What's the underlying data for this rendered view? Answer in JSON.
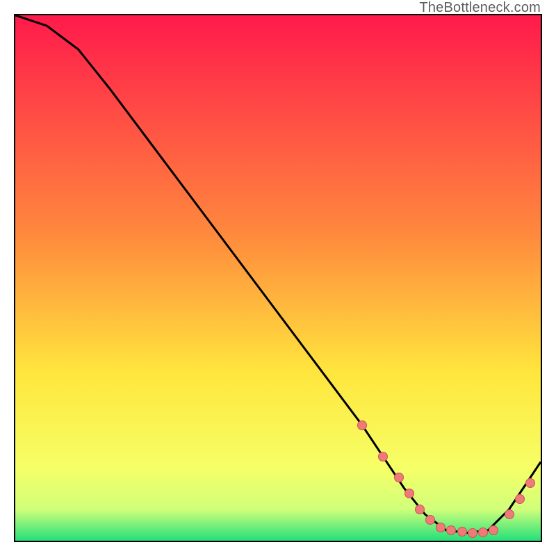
{
  "watermark": "TheBottleneck.com",
  "colors": {
    "top": "#ff1a4b",
    "mid1": "#ff8a3d",
    "mid2": "#ffe63d",
    "mid3": "#f6ff66",
    "mid4": "#d1ff7a",
    "bottom": "#23e07a",
    "curve": "#000000",
    "dot_fill": "#f07a78",
    "dot_stroke": "#c95553"
  },
  "chart_data": {
    "type": "line",
    "title": "",
    "xlabel": "",
    "ylabel": "",
    "xlim": [
      0,
      100
    ],
    "ylim": [
      0,
      100
    ],
    "grid": false,
    "series": [
      {
        "name": "curve",
        "x": [
          0,
          6,
          12,
          18,
          24,
          30,
          36,
          42,
          48,
          54,
          60,
          66,
          70,
          74,
          78,
          82,
          86,
          90,
          94,
          100
        ],
        "values": [
          100,
          98,
          93.5,
          86,
          78,
          70,
          62,
          54,
          46,
          38,
          30,
          22,
          16,
          10,
          5,
          2,
          1.5,
          2,
          6,
          15
        ]
      }
    ],
    "scatter": {
      "name": "dots",
      "x": [
        66,
        70,
        73,
        75,
        77,
        79,
        81,
        83,
        85,
        87,
        89,
        91,
        94,
        96,
        98
      ],
      "values": [
        22,
        16,
        12,
        9,
        6,
        4,
        2.5,
        2,
        1.7,
        1.5,
        1.6,
        2,
        5,
        8,
        11
      ],
      "radius": 6
    }
  }
}
